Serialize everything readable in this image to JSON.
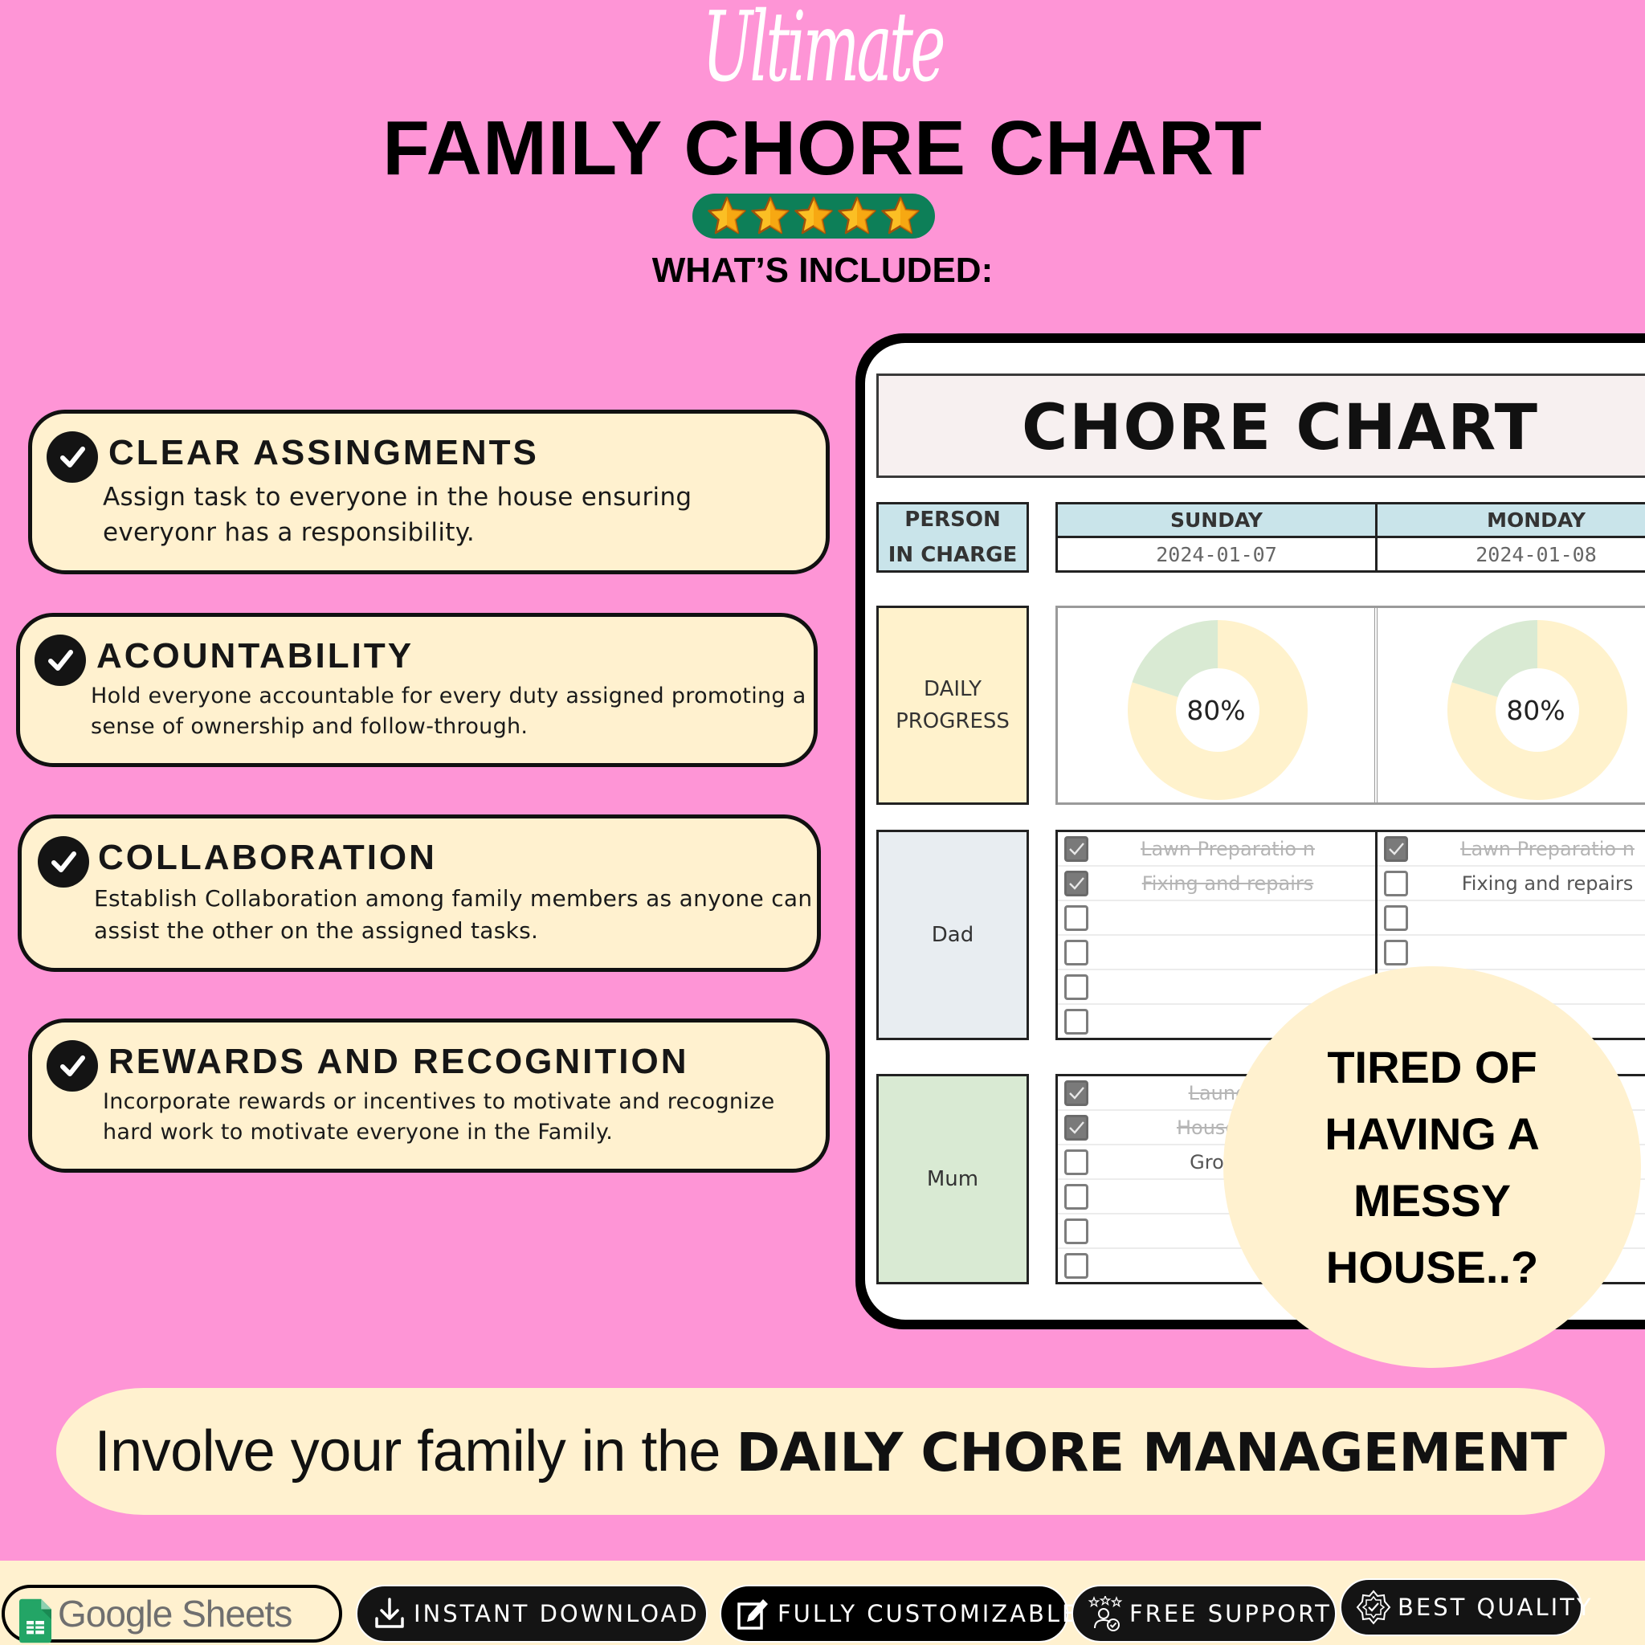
{
  "header": {
    "script_title": "Ultimate",
    "title": "FAMILY CHORE CHART",
    "rating_stars": 5,
    "rating_max": 5,
    "included_heading": "WHAT’S INCLUDED:"
  },
  "features": [
    {
      "title": "CLEAR ASSINGMENTS",
      "description": "Assign task to everyone in the house ensuring everyonr has a responsibility."
    },
    {
      "title": "ACOUNTABILITY",
      "description": "Hold everyone accountable for every duty assigned promoting a sense of ownership and follow-through."
    },
    {
      "title": "COLLABORATION",
      "description": "Establish Collaboration among family members as anyone can assist the other on the assigned tasks."
    },
    {
      "title": "REWARDS AND RECOGNITION",
      "description": "Incorporate rewards or incentives to motivate and recognize hard work to motivate everyone in the Family."
    }
  ],
  "sheet": {
    "title": "CHORE CHART",
    "person_header_line1": "PERSON",
    "person_header_line2": "IN CHARGE",
    "days": [
      {
        "name": "SUNDAY",
        "date": "2024-01-07",
        "progress_label": "80%",
        "progress": 0.8
      },
      {
        "name": "MONDAY",
        "date": "2024-01-08",
        "progress_label": "80%",
        "progress": 0.8
      }
    ],
    "progress_label_line1": "DAILY",
    "progress_label_line2": "PROGRESS",
    "colors": {
      "donut_done": "#fff2cc",
      "donut_remaining": "#d9ead3"
    },
    "people": [
      {
        "name": "Dad",
        "days": [
          [
            {
              "task": "Lawn Preparatio n",
              "checked": true
            },
            {
              "task": "Fixing and repairs",
              "checked": true
            },
            {
              "task": "",
              "checked": false
            },
            {
              "task": "",
              "checked": false
            },
            {
              "task": "",
              "checked": false
            },
            {
              "task": "",
              "checked": false
            }
          ],
          [
            {
              "task": "Lawn Preparatio n",
              "checked": true
            },
            {
              "task": "Fixing and repairs",
              "checked": false
            },
            {
              "task": "",
              "checked": false
            },
            {
              "task": "",
              "checked": false
            },
            {
              "task": "",
              "checked": false
            },
            {
              "task": "",
              "checked": false
            }
          ]
        ]
      },
      {
        "name": "Mum",
        "days": [
          [
            {
              "task": "Laundry",
              "checked": true
            },
            {
              "task": "Household",
              "checked": true
            },
            {
              "task": "Grocery",
              "checked": false
            },
            {
              "task": "",
              "checked": false
            },
            {
              "task": "",
              "checked": false
            },
            {
              "task": "",
              "checked": false
            }
          ],
          [
            {
              "task": "",
              "checked": false
            },
            {
              "task": "",
              "checked": false
            },
            {
              "task": "",
              "checked": false
            },
            {
              "task": "",
              "checked": false
            },
            {
              "task": "",
              "checked": false
            },
            {
              "task": "",
              "checked": false
            }
          ]
        ]
      }
    ]
  },
  "bubble": {
    "lines": [
      "TIRED OF",
      "HAVING A",
      "MESSY",
      "HOUSE..?"
    ]
  },
  "banner": {
    "text_light": "Involve your family in the ",
    "text_bold": "DAILY CHORE MANAGEMENT"
  },
  "badges": {
    "google_sheets": "Google Sheets",
    "instant_download": "INSTANT DOWNLOAD",
    "fully_customizable": "FULLY CUSTOMIZABLE",
    "free_support": "FREE SUPPORT",
    "best_quality": "BEST QUALITY"
  },
  "colors": {
    "background": "#fe95d6",
    "cream": "#fff1cf",
    "rating_green": "#0d7f58",
    "header_blue": "#c9e4ea",
    "dad_gray": "#e8edf1",
    "mum_green": "#d9ead3"
  }
}
